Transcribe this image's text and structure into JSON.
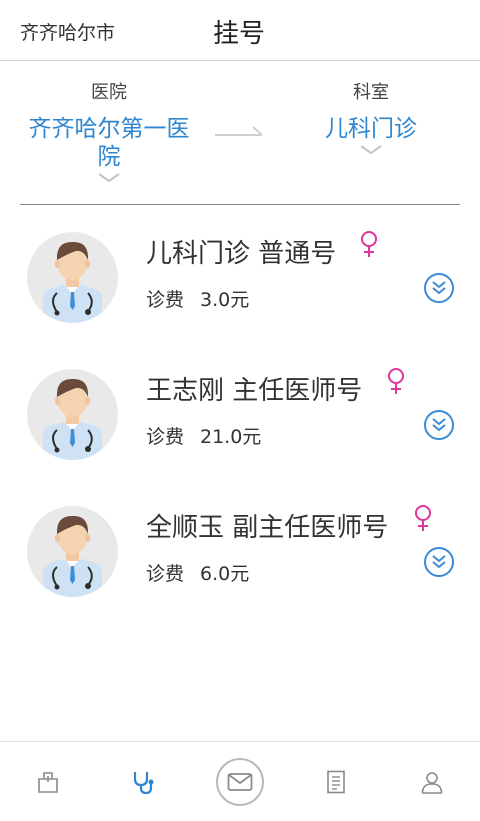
{
  "header": {
    "city": "齐齐哈尔市",
    "title": "挂号"
  },
  "selector": {
    "hospital_label": "医院",
    "hospital_value": "齐齐哈尔第一医院",
    "department_label": "科室",
    "department_value": "儿科门诊"
  },
  "doctors": [
    {
      "name": "儿科门诊  普通号",
      "fee_label": "诊费",
      "fee": "3.0元",
      "gender": "female"
    },
    {
      "name": "王志刚  主任医师号",
      "fee_label": "诊费",
      "fee": "21.0元",
      "gender": "female"
    },
    {
      "name": "全顺玉  副主任医师号",
      "fee_label": "诊费",
      "fee": "6.0元",
      "gender": "female"
    }
  ],
  "colors": {
    "accent_blue": "#2f86d0",
    "gender_pink": "#e0359a",
    "icon_gray": "#8a8a8a"
  },
  "tabbar": {
    "icons": [
      "hospital-icon",
      "stethoscope-icon",
      "mail-icon",
      "report-icon",
      "user-icon"
    ],
    "active": "stethoscope-icon"
  }
}
